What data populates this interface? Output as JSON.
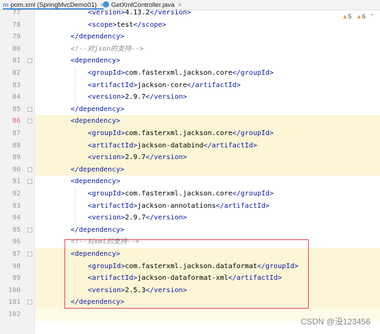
{
  "tabs": [
    {
      "icon": "m",
      "label": "pom.xml (SpringMvcDemo01)",
      "active": true
    },
    {
      "icon": "c",
      "label": "GetXmlController.java",
      "active": false
    }
  ],
  "warnings": {
    "warn_count": "5",
    "weak_count": "6"
  },
  "lines": [
    {
      "n": "77",
      "indent": 2,
      "tokens": [
        [
          "tag",
          "<version>"
        ],
        [
          "txt",
          "4.13.2"
        ],
        [
          "tag",
          "</version>"
        ]
      ]
    },
    {
      "n": "78",
      "indent": 2,
      "tokens": [
        [
          "tag",
          "<scope>"
        ],
        [
          "txt",
          "test"
        ],
        [
          "tag",
          "</scope>"
        ]
      ]
    },
    {
      "n": "79",
      "indent": 1,
      "tokens": [
        [
          "tag",
          "</dependency>"
        ]
      ]
    },
    {
      "n": "80",
      "indent": 1,
      "tokens": [
        [
          "com",
          "<!--对json的支持-->"
        ]
      ]
    },
    {
      "n": "81",
      "indent": 1,
      "tokens": [
        [
          "tag",
          "<dependency>"
        ]
      ]
    },
    {
      "n": "82",
      "indent": 2,
      "tokens": [
        [
          "tag",
          "<groupId>"
        ],
        [
          "txt",
          "com.fasterxml.jackson.core"
        ],
        [
          "tag",
          "</groupId>"
        ]
      ]
    },
    {
      "n": "83",
      "indent": 2,
      "tokens": [
        [
          "tag",
          "<artifactId>"
        ],
        [
          "txt",
          "jackson-core"
        ],
        [
          "tag",
          "</artifactId>"
        ]
      ]
    },
    {
      "n": "84",
      "indent": 2,
      "tokens": [
        [
          "tag",
          "<version>"
        ],
        [
          "txt",
          "2.9.7"
        ],
        [
          "tag",
          "</version>"
        ]
      ]
    },
    {
      "n": "85",
      "indent": 1,
      "tokens": [
        [
          "tag",
          "</dependency>"
        ]
      ]
    },
    {
      "n": "86",
      "indent": 1,
      "tokens": [
        [
          "tag",
          "<dependency>"
        ]
      ]
    },
    {
      "n": "87",
      "indent": 2,
      "tokens": [
        [
          "tag",
          "<groupId>"
        ],
        [
          "txt",
          "com.fasterxml.jackson.core"
        ],
        [
          "tag",
          "</groupId>"
        ]
      ]
    },
    {
      "n": "88",
      "indent": 2,
      "tokens": [
        [
          "tag",
          "<artifactId>"
        ],
        [
          "txt",
          "jackson-databind"
        ],
        [
          "tag",
          "</artifactId>"
        ]
      ]
    },
    {
      "n": "89",
      "indent": 2,
      "tokens": [
        [
          "tag",
          "<version>"
        ],
        [
          "txt",
          "2.9.7"
        ],
        [
          "tag",
          "</version>"
        ]
      ]
    },
    {
      "n": "90",
      "indent": 1,
      "tokens": [
        [
          "tag",
          "</dependency>"
        ]
      ]
    },
    {
      "n": "91",
      "indent": 1,
      "tokens": [
        [
          "tag",
          "<dependency>"
        ]
      ]
    },
    {
      "n": "92",
      "indent": 2,
      "tokens": [
        [
          "tag",
          "<groupId>"
        ],
        [
          "txt",
          "com.fasterxml.jackson.core"
        ],
        [
          "tag",
          "</groupId>"
        ]
      ]
    },
    {
      "n": "93",
      "indent": 2,
      "tokens": [
        [
          "tag",
          "<artifactId>"
        ],
        [
          "txt",
          "jackson-annotations"
        ],
        [
          "tag",
          "</artifactId>"
        ]
      ]
    },
    {
      "n": "94",
      "indent": 2,
      "tokens": [
        [
          "tag",
          "<version>"
        ],
        [
          "txt",
          "2.9.7"
        ],
        [
          "tag",
          "</version>"
        ]
      ]
    },
    {
      "n": "95",
      "indent": 1,
      "tokens": [
        [
          "tag",
          "</dependency>"
        ]
      ]
    },
    {
      "n": "96",
      "indent": 1,
      "tokens": [
        [
          "com",
          "<!--对xml的支持-->"
        ]
      ]
    },
    {
      "n": "97",
      "indent": 1,
      "tokens": [
        [
          "tag",
          "<dependency>"
        ]
      ]
    },
    {
      "n": "98",
      "indent": 2,
      "tokens": [
        [
          "tag",
          "<groupId>"
        ],
        [
          "txt",
          "com.fasterxml.jackson.dataformat"
        ],
        [
          "tag",
          "</groupId>"
        ]
      ]
    },
    {
      "n": "99",
      "indent": 2,
      "tokens": [
        [
          "tag",
          "<artifactId>"
        ],
        [
          "txt",
          "jackson-dataformat-xml"
        ],
        [
          "tag",
          "</artifactId>"
        ]
      ]
    },
    {
      "n": "100",
      "indent": 2,
      "tokens": [
        [
          "tag",
          "<version>"
        ],
        [
          "txt",
          "2.5.3"
        ],
        [
          "tag",
          "</version>"
        ]
      ]
    },
    {
      "n": "101",
      "indent": 1,
      "tokens": [
        [
          "tag",
          "</dependency>"
        ]
      ]
    },
    {
      "n": "102",
      "indent": 0,
      "tokens": []
    }
  ],
  "watermark": "CSDN @没123456"
}
